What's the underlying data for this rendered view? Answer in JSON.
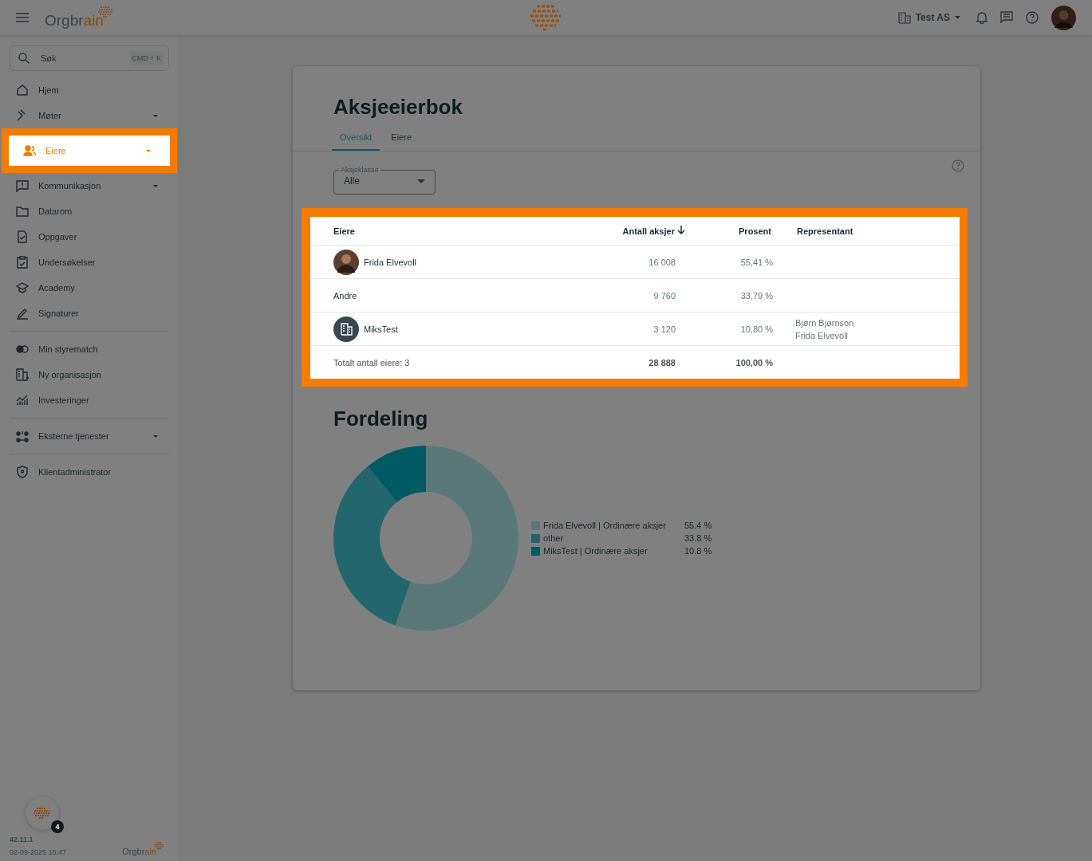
{
  "header": {
    "logo": [
      "Orgbr",
      "ain"
    ],
    "company": "Test AS"
  },
  "sidebar": {
    "search": {
      "placeholder": "Søk",
      "shortcut": "CMD + K"
    },
    "groups": [
      [
        {
          "label": "Hjem",
          "expandable": false,
          "selected": false
        },
        {
          "label": "Møter",
          "expandable": true,
          "selected": false
        },
        {
          "label": "Eiere",
          "expandable": true,
          "selected": true
        },
        {
          "label": "Kommunikasjon",
          "expandable": true,
          "selected": false
        },
        {
          "label": "Datarom",
          "expandable": false,
          "selected": false
        },
        {
          "label": "Oppgaver",
          "expandable": false,
          "selected": false
        },
        {
          "label": "Undersøkelser",
          "expandable": false,
          "selected": false
        },
        {
          "label": "Academy",
          "expandable": false,
          "selected": false
        },
        {
          "label": "Signaturer",
          "expandable": false,
          "selected": false
        }
      ],
      [
        {
          "label": "Min styrematch",
          "expandable": false,
          "selected": false
        },
        {
          "label": "Ny organisasjon",
          "expandable": false,
          "selected": false
        },
        {
          "label": "Investeringer",
          "expandable": false,
          "selected": false
        }
      ],
      [
        {
          "label": "Eksterne tjenester",
          "expandable": true,
          "selected": false
        }
      ],
      [
        {
          "label": "Klientadministrator",
          "expandable": false,
          "selected": false
        }
      ]
    ],
    "badge": "4",
    "version": "42.11.1",
    "timestamp": "02-09-2025 15:47",
    "footer_logo": [
      "Orgbr",
      "ain"
    ]
  },
  "page": {
    "title": "Aksjeeierbok",
    "tabs": [
      {
        "label": "Oversikt",
        "selected": true
      },
      {
        "label": "Eiere",
        "selected": false
      }
    ],
    "filter": {
      "label": "Aksjeklasse",
      "value": "Alle"
    },
    "table": {
      "columns": [
        "Eiere",
        "Antall aksjer",
        "Prosent",
        "Representant"
      ],
      "rows": [
        {
          "kind": "person",
          "owner": "Frida Elvevoll",
          "shares": "16 008",
          "percent": "55,41 %",
          "representatives": []
        },
        {
          "kind": "plain",
          "owner": "Andre",
          "shares": "9 760",
          "percent": "33,79 %",
          "representatives": []
        },
        {
          "kind": "company",
          "owner": "MiksTest",
          "shares": "3 120",
          "percent": "10,80 %",
          "representatives": [
            "Bjørn Bjørnson",
            "Frida Elvevoll"
          ]
        }
      ],
      "total": {
        "label": "Totalt antall eiere: 3",
        "shares": "28 888",
        "percent": "100,00 %"
      }
    },
    "distribution": {
      "title": "Fordeling",
      "chart_data": {
        "type": "donut",
        "categories": [
          "Frida Elvevoll | Ordinære aksjer",
          "other",
          "MiksTest | Ordinære aksjer"
        ],
        "values": [
          55.4,
          33.8,
          10.8
        ],
        "value_labels": [
          "55.4 %",
          "33.8 %",
          "10.8 %"
        ],
        "colors": [
          "#5a7878",
          "#24666e",
          "#005a64"
        ],
        "legend": "right"
      }
    }
  }
}
